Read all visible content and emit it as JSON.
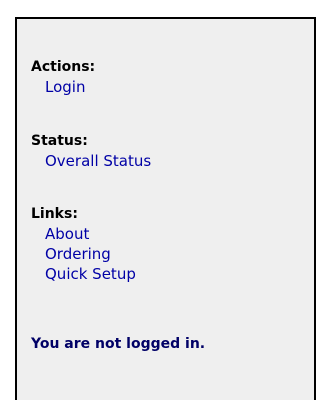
{
  "sidebar": {
    "actions": {
      "heading": "Actions:",
      "items": [
        {
          "label": "Login"
        }
      ]
    },
    "status": {
      "heading": "Status:",
      "items": [
        {
          "label": "Overall Status"
        }
      ]
    },
    "links": {
      "heading": "Links:",
      "items": [
        {
          "label": "About"
        },
        {
          "label": "Ordering"
        },
        {
          "label": "Quick Setup"
        }
      ]
    },
    "login_status": "You are not logged in."
  },
  "colors": {
    "panel_background": "#efefef",
    "link": "#0000a6",
    "status_text": "#000066",
    "border": "#000000"
  }
}
